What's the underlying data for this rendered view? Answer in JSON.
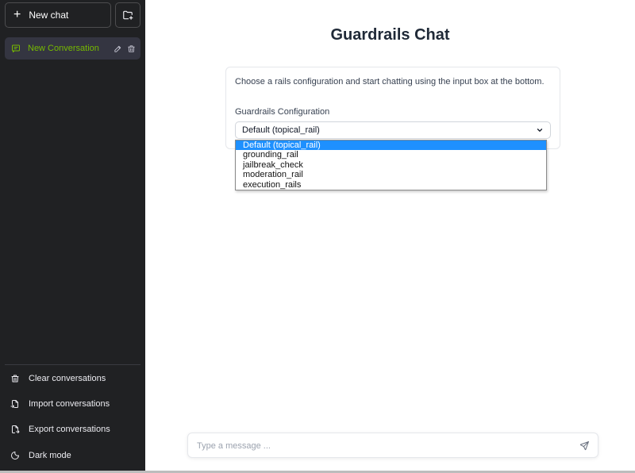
{
  "sidebar": {
    "new_chat_label": "New chat",
    "conversations": [
      {
        "label": "New Conversation"
      }
    ],
    "bottom": {
      "clear": "Clear conversations",
      "import": "Import conversations",
      "export": "Export conversations",
      "dark": "Dark mode"
    }
  },
  "main": {
    "title": "Guardrails Chat",
    "intro": "Choose a rails configuration and start chatting using the input box at the bottom.",
    "config_label": "Guardrails Configuration",
    "selected_option": "Default (topical_rail)",
    "options": [
      "Default (topical_rail)",
      "grounding_rail",
      "jailbreak_check",
      "moderation_rail",
      "execution_rails"
    ]
  },
  "input": {
    "placeholder": "Type a message ..."
  },
  "colors": {
    "sidebar_bg": "#202123",
    "accent": "#76b900",
    "selected_option": "#1e90ff"
  }
}
